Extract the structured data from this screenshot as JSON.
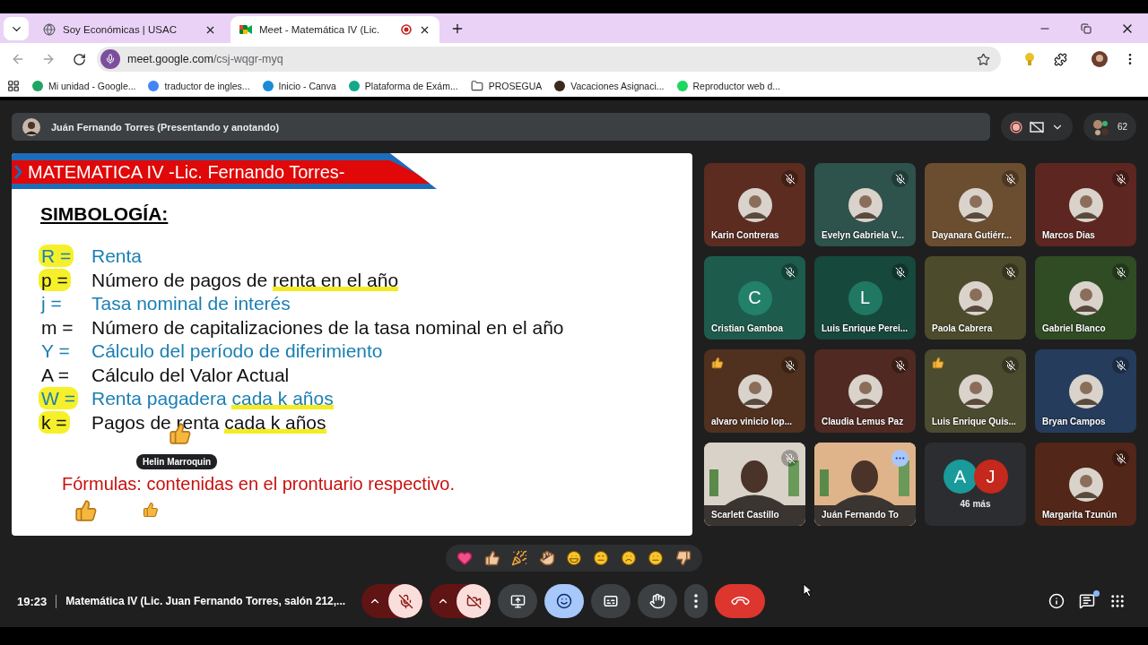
{
  "browser": {
    "tabs": [
      {
        "title": "Soy Económicas | USAC",
        "selected": false,
        "recording": false
      },
      {
        "title": "Meet - Matemática IV (Lic.",
        "selected": true,
        "recording": true
      }
    ],
    "url_host": "meet.google.com",
    "url_path": "/csj-wqgr-myq",
    "bookmarks": [
      {
        "label": "Mi unidad - Google...",
        "kind": "site",
        "color": "#1fa463"
      },
      {
        "label": "traductor de ingles...",
        "kind": "site",
        "color": "#4285f4"
      },
      {
        "label": "Inicio - Canva",
        "kind": "site",
        "color": "#1c8ad8"
      },
      {
        "label": "Plataforma de Exám...",
        "kind": "site",
        "color": "#13a88a"
      },
      {
        "label": "PROSEGUA",
        "kind": "folder",
        "color": "#444746"
      },
      {
        "label": "Vacaciones Asignaci...",
        "kind": "site",
        "color": "#3a2a1e"
      },
      {
        "label": "Reproductor web d...",
        "kind": "site",
        "color": "#1ed760"
      }
    ]
  },
  "meet": {
    "presenter_bar": {
      "label": "Juán Fernando Torres (Presentando y anotando)"
    },
    "recording": true,
    "participant_count": "62",
    "slide": {
      "title": "MATEMATICA IV -Lic. Fernando Torres-",
      "heading": "SIMBOLOGÍA:",
      "lines": [
        {
          "symbol": "R =",
          "color": "#1a7fb3",
          "marked": true,
          "segments": [
            {
              "text": "Renta",
              "highlighted": false
            }
          ]
        },
        {
          "symbol": "p =",
          "color": "#111111",
          "marked": true,
          "segments": [
            {
              "text": "Número de pagos de ",
              "highlighted": false
            },
            {
              "text": "renta en el año",
              "highlighted": true
            }
          ]
        },
        {
          "symbol": "j =",
          "color": "#1a7fb3",
          "marked": false,
          "segments": [
            {
              "text": "Tasa nominal de interés",
              "highlighted": false
            }
          ]
        },
        {
          "symbol": "m =",
          "color": "#111111",
          "marked": false,
          "segments": [
            {
              "text": "Número de capitalizaciones de la tasa nominal en el año",
              "highlighted": false
            }
          ]
        },
        {
          "symbol": "Y =",
          "color": "#1a7fb3",
          "marked": false,
          "segments": [
            {
              "text": "Cálculo del período de diferimiento",
              "highlighted": false
            }
          ]
        },
        {
          "symbol": "A =",
          "color": "#111111",
          "marked": false,
          "segments": [
            {
              "text": "Cálculo del Valor Actual",
              "highlighted": false
            }
          ]
        },
        {
          "symbol": "W =",
          "color": "#1a7fb3",
          "marked": true,
          "segments": [
            {
              "text": "Renta pagadera ",
              "highlighted": false
            },
            {
              "text": "cada k años",
              "highlighted": true
            }
          ]
        },
        {
          "symbol": "k =",
          "color": "#111111",
          "marked": true,
          "segments": [
            {
              "text": "Pagos de renta ",
              "highlighted": false
            },
            {
              "text": "cada k años",
              "highlighted": true
            }
          ]
        }
      ],
      "reaction_name": "Helin Marroquin",
      "formula_note": "Fórmulas: contenidas en el prontuario respectivo."
    },
    "tiles": [
      {
        "name": "Karin Contreras",
        "kind": "avatar",
        "color": "#5c2c20",
        "muted": true,
        "reaction": false,
        "speaking": false
      },
      {
        "name": "Evelyn Gabriela V...",
        "kind": "avatar",
        "color": "#2e524c",
        "muted": true,
        "reaction": false,
        "speaking": false
      },
      {
        "name": "Dayanara Gutiérr...",
        "kind": "avatar",
        "color": "#6b4d30",
        "muted": true,
        "reaction": false,
        "speaking": false
      },
      {
        "name": "Marcos Dias",
        "kind": "avatar",
        "color": "#5e2620",
        "muted": true,
        "reaction": false,
        "speaking": false
      },
      {
        "name": "Cristian Gamboa",
        "kind": "initial",
        "initial": "C",
        "color": "#1d5c4c",
        "muted": true,
        "reaction": false,
        "speaking": false
      },
      {
        "name": "Luis Enrique Perei...",
        "kind": "initial",
        "initial": "L",
        "color": "#17483c",
        "muted": true,
        "reaction": false,
        "speaking": false
      },
      {
        "name": "Paola Cabrera",
        "kind": "avatar",
        "color": "#4c4c2c",
        "muted": true,
        "reaction": false,
        "speaking": false
      },
      {
        "name": "Gabriel Blanco",
        "kind": "avatar",
        "color": "#2f4c24",
        "muted": true,
        "reaction": false,
        "speaking": false
      },
      {
        "name": "alvaro vinicio lop...",
        "kind": "avatar",
        "color": "#50301f",
        "muted": true,
        "reaction": true,
        "speaking": false
      },
      {
        "name": "Claudia Lemus Paz",
        "kind": "avatar",
        "color": "#502a22",
        "muted": true,
        "reaction": false,
        "speaking": false
      },
      {
        "name": "Luis Enrique Quis...",
        "kind": "avatar",
        "color": "#4b4b30",
        "muted": true,
        "reaction": true,
        "speaking": false
      },
      {
        "name": "Bryan Campos",
        "kind": "avatar",
        "color": "#253c5c",
        "muted": true,
        "reaction": false,
        "speaking": false
      },
      {
        "name": "Scarlett Castillo",
        "kind": "video",
        "color": "#d8d2c8",
        "muted": true,
        "reaction": false,
        "speaking": false
      },
      {
        "name": "Juán Fernando To",
        "kind": "video",
        "color": "#e0b48a",
        "muted": false,
        "reaction": false,
        "speaking": true
      },
      {
        "kind": "overflow",
        "color": "#2c2d30",
        "initials": [
          {
            "letter": "A",
            "color": "#1a9a9a"
          },
          {
            "letter": "J",
            "color": "#c5281c"
          }
        ],
        "label": "46 más"
      },
      {
        "name": "Margarita Tzunún",
        "kind": "avatar",
        "color": "#522618",
        "muted": true,
        "reaction": false,
        "speaking": false
      }
    ],
    "reactions": [
      {
        "kind": "heart"
      },
      {
        "kind": "thumbs-up"
      },
      {
        "kind": "party"
      },
      {
        "kind": "clap"
      },
      {
        "kind": "laugh"
      },
      {
        "kind": "surprised"
      },
      {
        "kind": "sad"
      },
      {
        "kind": "thinking"
      },
      {
        "kind": "thumbs-down"
      }
    ],
    "time": "19:23",
    "meeting_title": "Matemática IV (Lic. Juan Fernando Torres, salón 212,...",
    "controls": [
      {
        "kind": "mic",
        "off": true
      },
      {
        "kind": "camera",
        "off": true
      },
      {
        "kind": "present",
        "selected": false
      },
      {
        "kind": "reactions",
        "selected": true
      },
      {
        "kind": "captions",
        "selected": false
      },
      {
        "kind": "hand",
        "selected": false
      },
      {
        "kind": "more"
      },
      {
        "kind": "end"
      }
    ],
    "chat_unread": true
  }
}
